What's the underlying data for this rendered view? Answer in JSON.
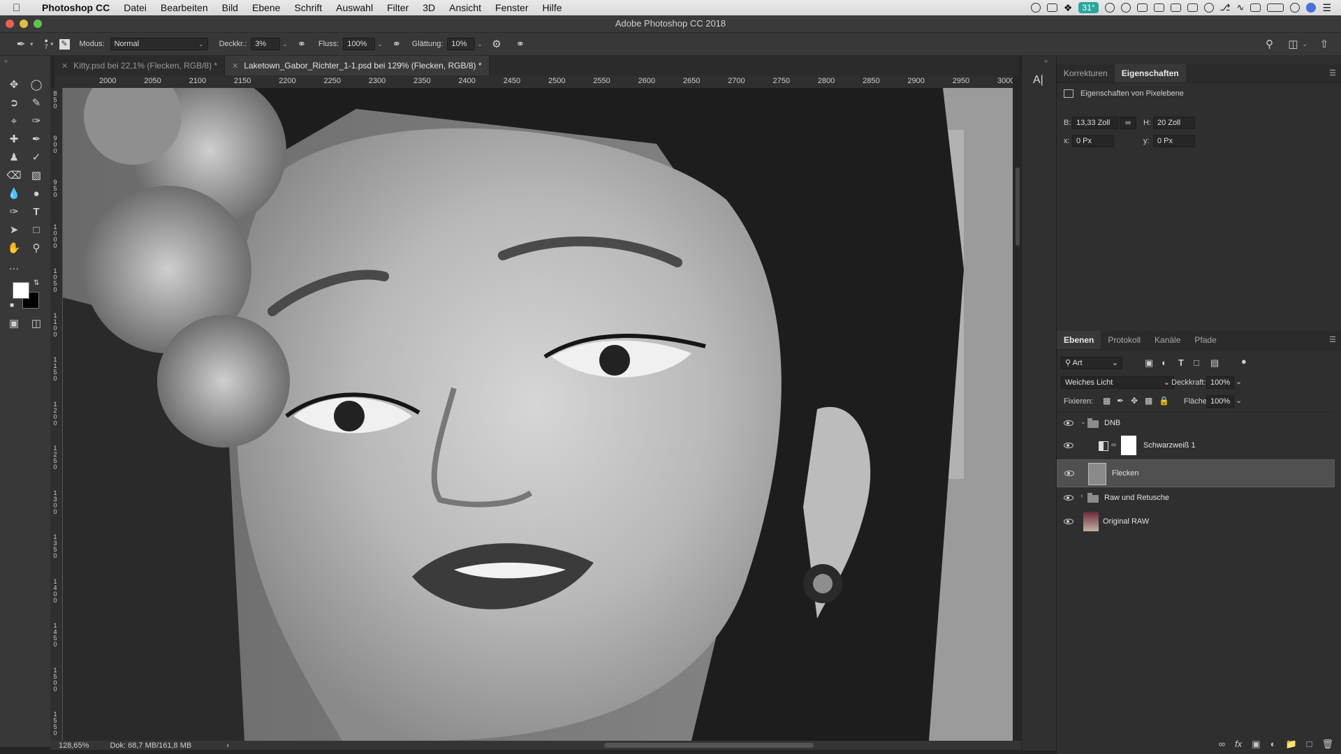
{
  "menubar": {
    "items": [
      "Photoshop CC",
      "Datei",
      "Bearbeiten",
      "Bild",
      "Ebene",
      "Schrift",
      "Auswahl",
      "Filter",
      "3D",
      "Ansicht",
      "Fenster",
      "Hilfe"
    ],
    "temperature": "31°"
  },
  "window": {
    "title": "Adobe Photoshop CC 2018"
  },
  "options": {
    "brush_size": "7",
    "modus_label": "Modus:",
    "modus_value": "Normal",
    "deckkr_label": "Deckkr.:",
    "deckkr_value": "3%",
    "fluss_label": "Fluss:",
    "fluss_value": "100%",
    "glaettung_label": "Glättung:",
    "glaettung_value": "10%"
  },
  "tabs": [
    {
      "label": "Kitty.psd bei 22,1% (Flecken, RGB/8) *"
    },
    {
      "label": "Laketown_Gabor_Richter_1-1.psd bei 129% (Flecken, RGB/8) *"
    }
  ],
  "ruler": {
    "h": [
      "2000",
      "2050",
      "2100",
      "2150",
      "2200",
      "2250",
      "2300",
      "2350",
      "2400",
      "2450",
      "2500",
      "2550",
      "2600",
      "2650",
      "2700",
      "2750",
      "2800",
      "2850",
      "2900",
      "2950",
      "3000"
    ],
    "v": [
      "850",
      "900",
      "950",
      "1000",
      "1050",
      "1100",
      "1150",
      "1200",
      "1250",
      "1300",
      "1350",
      "1400",
      "1450",
      "1500",
      "1550"
    ]
  },
  "status": {
    "zoom": "128,65%",
    "doc": "Dok: 68,7 MB/161,8 MB"
  },
  "properties": {
    "tabs": [
      "Korrekturen",
      "Eigenschaften"
    ],
    "header": "Eigenschaften von Pixelebene",
    "b_label": "B:",
    "b_value": "13,33 Zoll",
    "h_label": "H:",
    "h_value": "20 Zoll",
    "x_label": "x:",
    "x_value": "0 Px",
    "y_label": "y:",
    "y_value": "0 Px"
  },
  "layers_panel": {
    "tabs": [
      "Ebenen",
      "Protokoll",
      "Kanäle",
      "Pfade"
    ],
    "filter": "Art",
    "blend": "Weiches Licht",
    "deckkraft_label": "Deckkraft:",
    "deckkraft_value": "100%",
    "fixieren_label": "Fixieren:",
    "flaeche_label": "Fläche:",
    "flaeche_value": "100%",
    "layers": [
      {
        "name": "DNB"
      },
      {
        "name": "Schwarzweiß 1"
      },
      {
        "name": "Flecken"
      },
      {
        "name": "Raw und Retusche"
      },
      {
        "name": "Original RAW"
      }
    ]
  },
  "colors": {
    "accent": "#2aa6a0",
    "panel": "#2f2f2f",
    "selected_layer": "#505050"
  }
}
